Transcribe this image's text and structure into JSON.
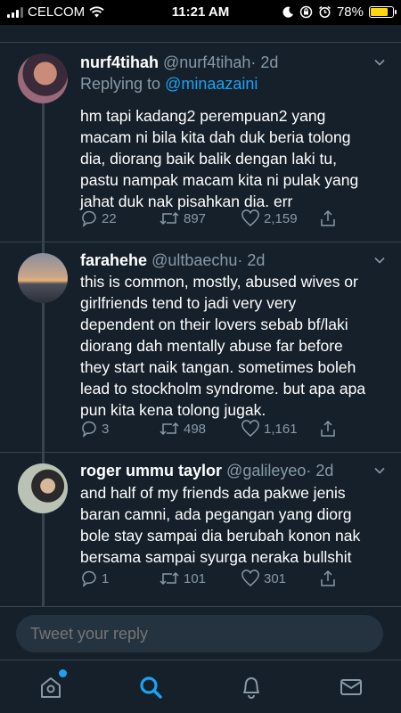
{
  "status_bar": {
    "carrier": "CELCOM",
    "time": "11:21 AM",
    "battery": "78%",
    "battery_level": 0.78,
    "icons": [
      "signal-icon",
      "wifi-icon",
      "moon-icon",
      "orientation-lock-icon",
      "alarm-icon",
      "battery-icon"
    ]
  },
  "tweets": [
    {
      "name": "nurf4tihah",
      "handle": "@nurf4tihah",
      "time": "· 2d",
      "replying_label": "Replying to",
      "replying_to": "@minaazaini",
      "text": "hm tapi kadang2 perempuan2 yang\nmacam ni bila kita dah duk beria tolong\ndia, diorang baik balik dengan laki tu,\npastu nampak macam kita ni pulak yang\njahat duk nak pisahkan dia. err",
      "replies": "22",
      "retweets": "897",
      "likes": "2,159"
    },
    {
      "name": "farahehe",
      "handle": "@ultbaechu",
      "time": "· 2d",
      "text": "this is common, mostly, abused wives or\ngirlfriends tend to jadi very very\ndependent on their lovers sebab bf/laki\ndiorang dah mentally abuse far before\nthey start naik tangan. sometimes boleh\nlead to stockholm syndrome. but apa apa\npun kita kena tolong jugak.",
      "replies": "3",
      "retweets": "498",
      "likes": "1,161"
    },
    {
      "name": "roger ummu taylor",
      "handle": "@galileyeo",
      "time": "· 2d",
      "text": "and half of my friends ada pakwe jenis\nbaran camni, ada pegangan yang diorg\nbole stay sampai dia berubah konon nak\nbersama sampai syurga neraka bullshit",
      "replies": "1",
      "retweets": "101",
      "likes": "301"
    }
  ],
  "reply_box": {
    "placeholder": "Tweet your reply"
  },
  "tabbar": {
    "items": [
      "home-icon",
      "search-icon",
      "notifications-icon",
      "messages-icon"
    ],
    "active": "search-icon"
  },
  "colors": {
    "background": "#15202b",
    "accent": "#1da1f2",
    "secondary_text": "#8899a6",
    "divider": "#38444d",
    "battery": "#ffd60a"
  }
}
